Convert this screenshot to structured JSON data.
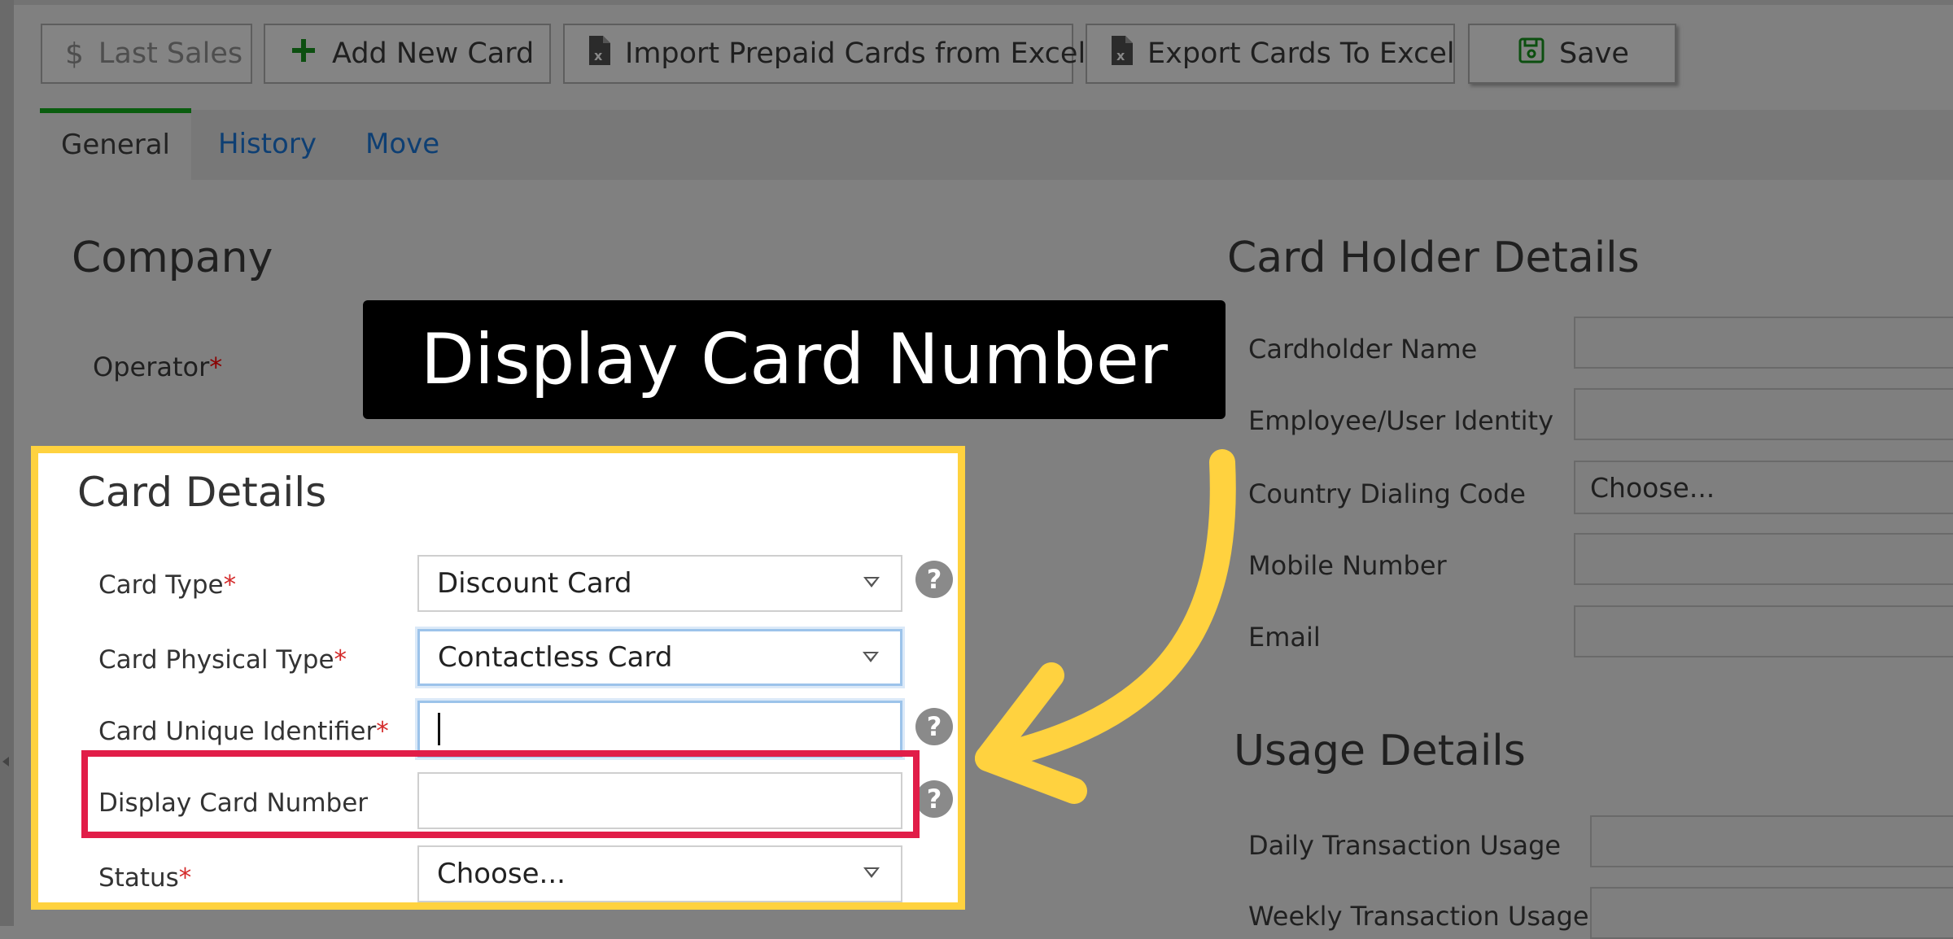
{
  "toolbar": {
    "last_sales": "Last Sales",
    "add_new_card": "Add New Card",
    "import": "Import Prepaid Cards from Excel",
    "export": "Export Cards To Excel",
    "save": "Save"
  },
  "tabs": [
    {
      "label": "General"
    },
    {
      "label": "History"
    },
    {
      "label": "Move"
    }
  ],
  "company": {
    "title": "Company",
    "operator_label": "Operator",
    "required_mark": "*"
  },
  "banner": {
    "text": "Display Card Number"
  },
  "card_details": {
    "title": "Card Details",
    "card_type": {
      "label": "Card Type",
      "value": "Discount Card"
    },
    "physical_type": {
      "label": "Card Physical Type",
      "value": "Contactless Card"
    },
    "unique_id": {
      "label": "Card Unique Identifier",
      "value": ""
    },
    "display_number": {
      "label": "Display Card Number",
      "value": ""
    },
    "status": {
      "label": "Status",
      "value": "Choose..."
    },
    "required_mark": "*",
    "help_glyph": "?"
  },
  "holder": {
    "title": "Card Holder Details",
    "name_label": "Cardholder Name",
    "identity_label": "Employee/User Identity",
    "dialing_label": "Country Dialing Code",
    "dialing_value": "Choose...",
    "mobile_label": "Mobile Number",
    "email_label": "Email"
  },
  "usage": {
    "title": "Usage Details",
    "daily_label": "Daily Transaction Usage",
    "weekly_label": "Weekly Transaction Usage"
  },
  "colors": {
    "highlight": "#ffd23f",
    "focus_box": "#e11d48",
    "arrow": "#ffd23f",
    "active_tab": "#0a5d0f"
  }
}
